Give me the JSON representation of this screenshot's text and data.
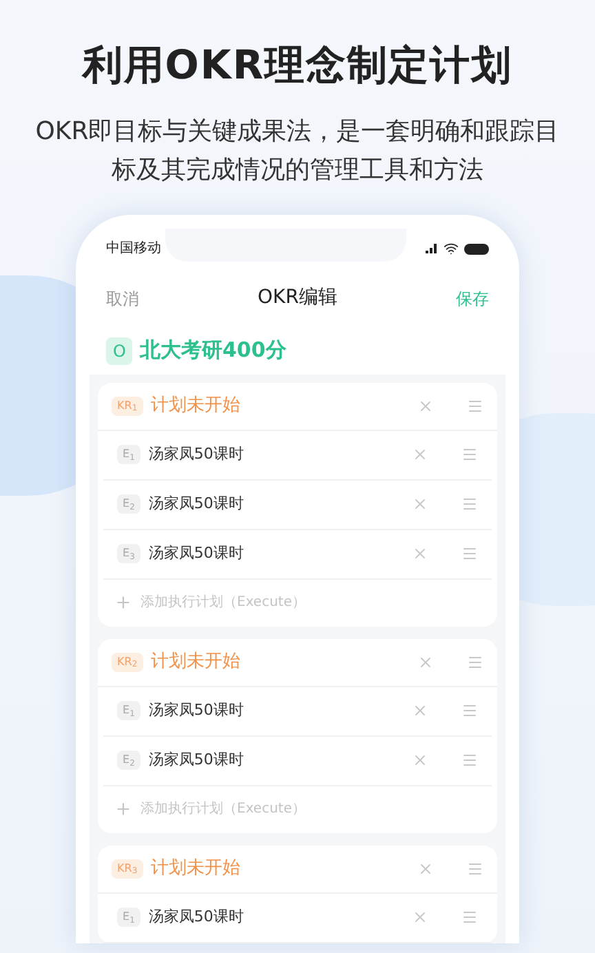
{
  "headline": "利用OKR理念制定计划",
  "subtitle": "OKR即目标与关键成果法，是一套明确和跟踪目标及其完成情况的管理工具和方法",
  "status_bar": {
    "carrier": "中国移动"
  },
  "nav": {
    "cancel": "取消",
    "title": "OKR编辑",
    "save": "保存"
  },
  "objective": {
    "badge": "O",
    "title": "北大考研400分"
  },
  "key_results": [
    {
      "badge": "KR$_{1}$",
      "title": "计划未开始",
      "executes": [
        {
          "badge": "E$_{1}$",
          "title": "汤家凤50课时"
        },
        {
          "badge": "E$_{2}$",
          "title": "汤家凤50课时"
        },
        {
          "badge": "E$_{3}$",
          "title": "汤家凤50课时"
        }
      ],
      "add_label": "添加执行计划（Execute）"
    },
    {
      "badge": "KR$_{2}$",
      "title": "计划未开始",
      "executes": [
        {
          "badge": "E$_{1}$",
          "title": "汤家凤50课时"
        },
        {
          "badge": "E$_{2}$",
          "title": "汤家凤50课时"
        }
      ],
      "add_label": "添加执行计划（Execute）"
    },
    {
      "badge": "KR$_{3}$",
      "title": "计划未开始",
      "executes": [
        {
          "badge": "E$_{1}$",
          "title": "汤家凤50课时"
        }
      ]
    }
  ]
}
